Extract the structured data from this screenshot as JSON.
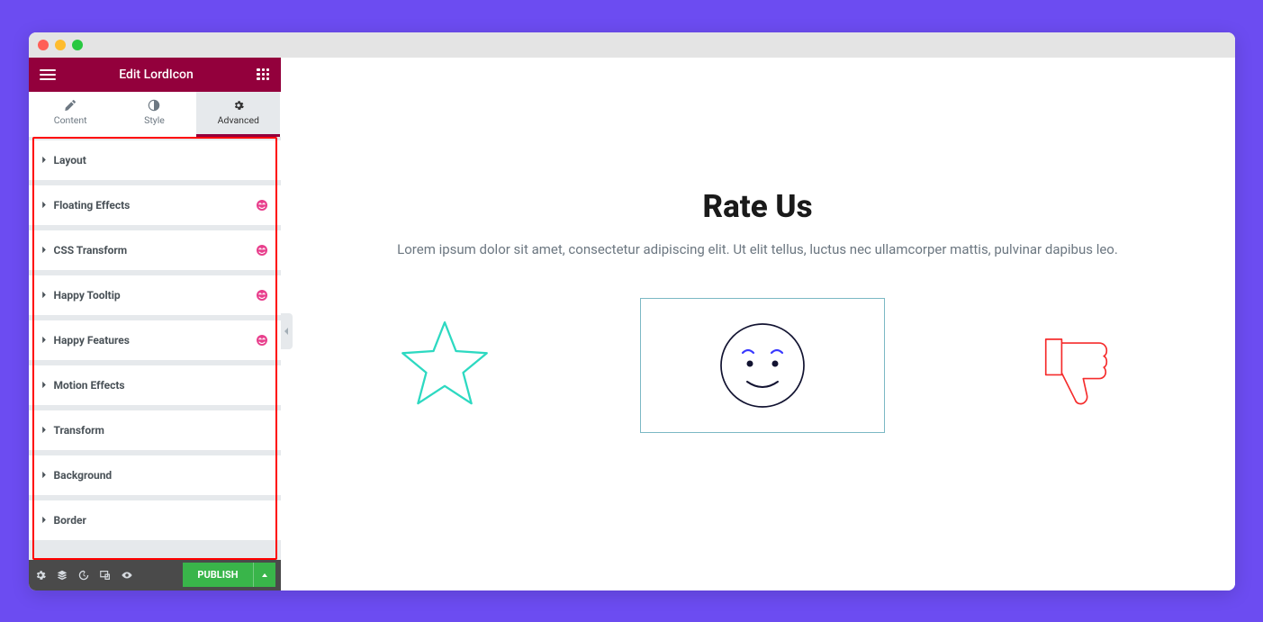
{
  "panel": {
    "title": "Edit LordIcon",
    "tabs": [
      "Content",
      "Style",
      "Advanced"
    ],
    "activeTab": 2,
    "sections": [
      {
        "label": "Layout",
        "happy": false
      },
      {
        "label": "Floating Effects",
        "happy": true
      },
      {
        "label": "CSS Transform",
        "happy": true
      },
      {
        "label": "Happy Tooltip",
        "happy": true
      },
      {
        "label": "Happy Features",
        "happy": true
      },
      {
        "label": "Motion Effects",
        "happy": false
      },
      {
        "label": "Transform",
        "happy": false
      },
      {
        "label": "Background",
        "happy": false
      },
      {
        "label": "Border",
        "happy": false
      }
    ],
    "publish": "PUBLISH"
  },
  "canvas": {
    "title": "Rate Us",
    "subtitle": "Lorem ipsum dolor sit amet, consectetur adipiscing elit. Ut elit tellus, luctus nec ullamcorper mattis, pulvinar dapibus leo."
  }
}
